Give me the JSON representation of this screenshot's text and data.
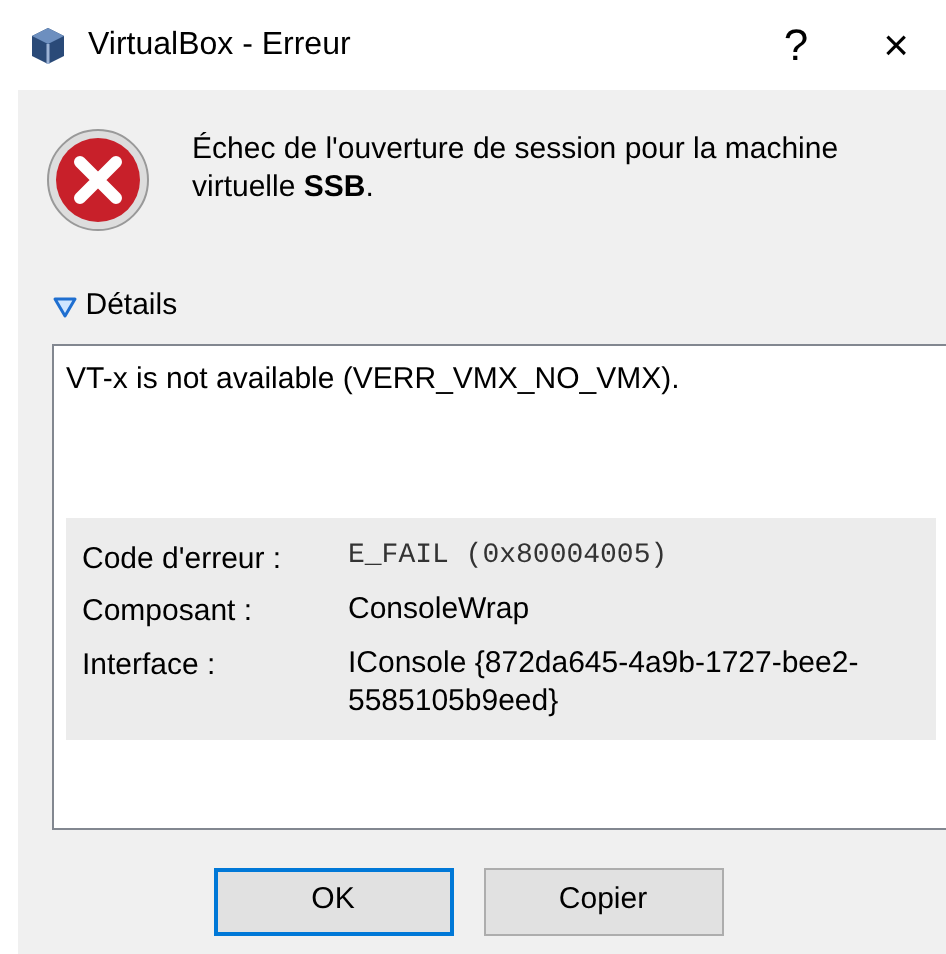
{
  "window": {
    "title": "VirtualBox - Erreur",
    "help": "?",
    "close": "×"
  },
  "message": "Échec de l'ouverture de session pour la machine virtuelle **SSB**.",
  "details": {
    "label": "Détails",
    "expanded": true,
    "text": "VT-x is not available (VERR_VMX_NO_VMX).",
    "fields": [
      {
        "label": "Code d'erreur :",
        "value": "E_FAIL (0x80004005)",
        "kind": "mono"
      },
      {
        "label": "Composant :",
        "value": "ConsoleWrap",
        "kind": "plain"
      },
      {
        "label": "Interface :",
        "value": "IConsole {872da645-4a9b-1727-bee2-5585105b9eed}",
        "kind": "plain"
      }
    ]
  },
  "buttons": [
    {
      "label": "OK",
      "default": true
    },
    {
      "label": "Copier",
      "default": false
    }
  ]
}
